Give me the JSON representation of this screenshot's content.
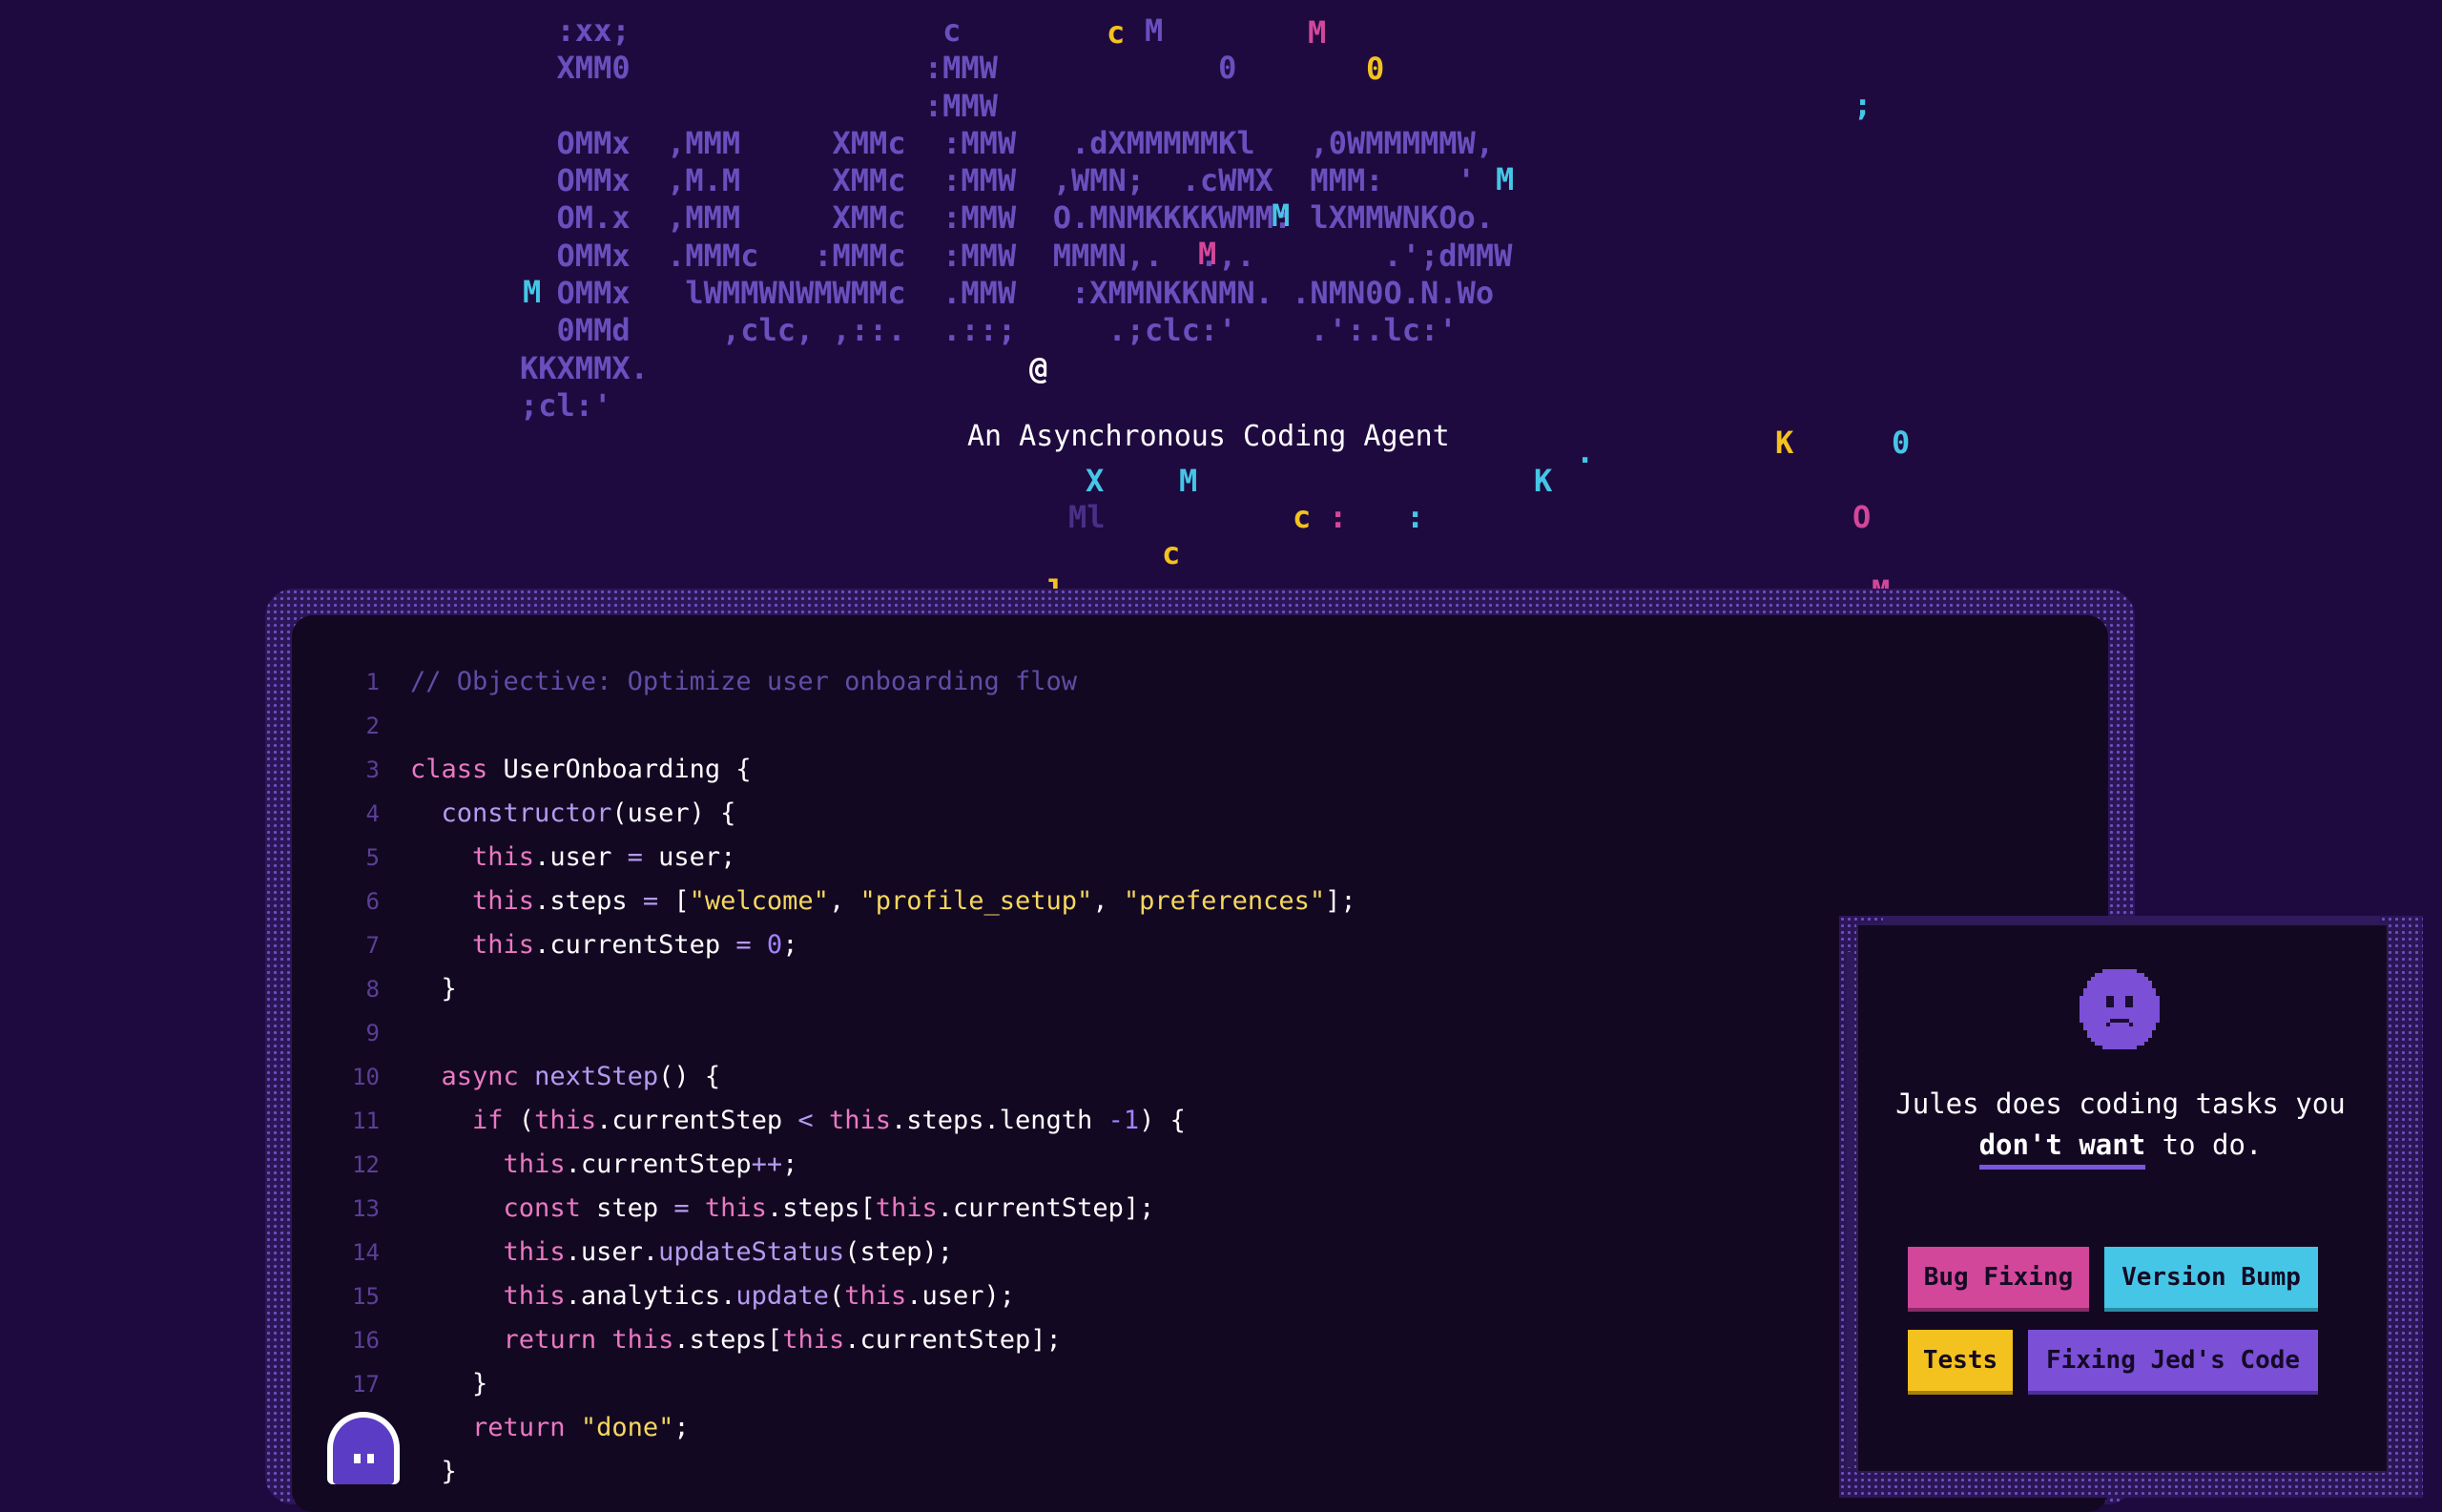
{
  "logo": {
    "ascii_lines": [
      "  :xx;                 c          M",
      "  XMM0                :MMW            0",
      "                      :MMW",
      "  OMMx  ,MMM     XMMc  :MMW   .dXMMMMMKl   ,0WMMMMMW,",
      "  OMMx  ,M.M     XMMc  :MMW  ,WMN;  .cWMX  MMM:    '",
      "  OM.x  ,MMM     XMMc  :MMW  O.MNMKKKKWMM: lXMMWNKOo.",
      "  OMMx  .MMMc   :MMMc  :MMW  MMMN,.  .,.       .';dMMW",
      "  OMMx   lWMMWNWMWMMc  .MMW   :XMMNKKNMN. .NMN0O.N.Wo",
      "  0MMd     ,clc, ,::.  .::;     .;clc:'    .':.lc:'",
      "KKXMMX.",
      ";cl:'"
    ],
    "floating_glyphs": [
      {
        "char": "c",
        "color": "#f4c21f"
      },
      {
        "char": "M",
        "color": "#d2479a"
      },
      {
        "char": "0",
        "color": "#f4c21f"
      },
      {
        "char": ";",
        "color": "#45c6e6"
      },
      {
        "char": "M",
        "color": "#45c6e6"
      },
      {
        "char": "M",
        "color": "#45c6e6"
      },
      {
        "char": "M",
        "color": "#d2479a"
      },
      {
        "char": "M",
        "color": "#45c6e6"
      },
      {
        "char": "@",
        "color": "#ffffff"
      },
      {
        "char": ".",
        "color": "#45c6e6"
      },
      {
        "char": "K",
        "color": "#f4c21f"
      },
      {
        "char": "0",
        "color": "#45c6e6"
      },
      {
        "char": "X",
        "color": "#45c6e6"
      },
      {
        "char": "M",
        "color": "#45c6e6"
      },
      {
        "char": "K",
        "color": "#45c6e6"
      },
      {
        "char": "Ml",
        "color": "#4a2f87"
      },
      {
        "char": "c",
        "color": "#f4c21f"
      },
      {
        "char": ":",
        "color": "#d2479a"
      },
      {
        "char": ":",
        "color": "#45c6e6"
      },
      {
        "char": "O",
        "color": "#d2479a"
      },
      {
        "char": "c",
        "color": "#f4c21f"
      },
      {
        "char": "l",
        "color": "#f4c21f"
      },
      {
        "char": "M",
        "color": "#d2479a"
      }
    ]
  },
  "subtitle": "An Asynchronous Coding Agent",
  "editor": {
    "lines": [
      {
        "n": "1",
        "tokens": [
          [
            "c-comment",
            "// Objective: Optimize user onboarding flow"
          ]
        ]
      },
      {
        "n": "2",
        "tokens": []
      },
      {
        "n": "3",
        "tokens": [
          [
            "c-kw",
            "class"
          ],
          [
            "c-plain",
            " UserOnboarding {"
          ]
        ]
      },
      {
        "n": "4",
        "tokens": [
          [
            "c-plain",
            "  "
          ],
          [
            "c-fn",
            "constructor"
          ],
          [
            "c-plain",
            "(user) {"
          ]
        ]
      },
      {
        "n": "5",
        "tokens": [
          [
            "c-plain",
            "    "
          ],
          [
            "c-this",
            "this"
          ],
          [
            "c-plain",
            ".user "
          ],
          [
            "c-op",
            "="
          ],
          [
            "c-plain",
            " user;"
          ]
        ]
      },
      {
        "n": "6",
        "tokens": [
          [
            "c-plain",
            "    "
          ],
          [
            "c-this",
            "this"
          ],
          [
            "c-plain",
            ".steps "
          ],
          [
            "c-op",
            "="
          ],
          [
            "c-plain",
            " ["
          ],
          [
            "c-str",
            "\"welcome\""
          ],
          [
            "c-plain",
            ", "
          ],
          [
            "c-str",
            "\"profile_setup\""
          ],
          [
            "c-plain",
            ", "
          ],
          [
            "c-str",
            "\"preferences\""
          ],
          [
            "c-plain",
            "];"
          ]
        ]
      },
      {
        "n": "7",
        "tokens": [
          [
            "c-plain",
            "    "
          ],
          [
            "c-this",
            "this"
          ],
          [
            "c-plain",
            ".currentStep "
          ],
          [
            "c-op",
            "="
          ],
          [
            "c-plain",
            " "
          ],
          [
            "c-num",
            "0"
          ],
          [
            "c-plain",
            ";"
          ]
        ]
      },
      {
        "n": "8",
        "tokens": [
          [
            "c-plain",
            "  }"
          ]
        ]
      },
      {
        "n": "9",
        "tokens": []
      },
      {
        "n": "10",
        "tokens": [
          [
            "c-plain",
            "  "
          ],
          [
            "c-kw",
            "async"
          ],
          [
            "c-plain",
            " "
          ],
          [
            "c-fn",
            "nextStep"
          ],
          [
            "c-plain",
            "() {"
          ]
        ]
      },
      {
        "n": "11",
        "tokens": [
          [
            "c-plain",
            "    "
          ],
          [
            "c-kw",
            "if"
          ],
          [
            "c-plain",
            " ("
          ],
          [
            "c-this",
            "this"
          ],
          [
            "c-plain",
            ".currentStep "
          ],
          [
            "c-op",
            "<"
          ],
          [
            "c-plain",
            " "
          ],
          [
            "c-this",
            "this"
          ],
          [
            "c-plain",
            ".steps.length "
          ],
          [
            "c-num",
            "-1"
          ],
          [
            "c-plain",
            ") {"
          ]
        ]
      },
      {
        "n": "12",
        "tokens": [
          [
            "c-plain",
            "      "
          ],
          [
            "c-this",
            "this"
          ],
          [
            "c-plain",
            ".currentStep"
          ],
          [
            "c-op",
            "++"
          ],
          [
            "c-plain",
            ";"
          ]
        ]
      },
      {
        "n": "13",
        "tokens": [
          [
            "c-plain",
            "      "
          ],
          [
            "c-kw",
            "const"
          ],
          [
            "c-plain",
            " step "
          ],
          [
            "c-op",
            "="
          ],
          [
            "c-plain",
            " "
          ],
          [
            "c-this",
            "this"
          ],
          [
            "c-plain",
            ".steps["
          ],
          [
            "c-this",
            "this"
          ],
          [
            "c-plain",
            ".currentStep];"
          ]
        ]
      },
      {
        "n": "14",
        "tokens": [
          [
            "c-plain",
            "      "
          ],
          [
            "c-this",
            "this"
          ],
          [
            "c-plain",
            ".user."
          ],
          [
            "c-fn",
            "updateStatus"
          ],
          [
            "c-plain",
            "(step);"
          ]
        ]
      },
      {
        "n": "15",
        "tokens": [
          [
            "c-plain",
            "      "
          ],
          [
            "c-this",
            "this"
          ],
          [
            "c-plain",
            ".analytics."
          ],
          [
            "c-fn",
            "update"
          ],
          [
            "c-plain",
            "("
          ],
          [
            "c-this",
            "this"
          ],
          [
            "c-plain",
            ".user);"
          ]
        ]
      },
      {
        "n": "16",
        "tokens": [
          [
            "c-plain",
            "      "
          ],
          [
            "c-kw",
            "return"
          ],
          [
            "c-plain",
            " "
          ],
          [
            "c-this",
            "this"
          ],
          [
            "c-plain",
            ".steps["
          ],
          [
            "c-this",
            "this"
          ],
          [
            "c-plain",
            ".currentStep];"
          ]
        ]
      },
      {
        "n": "17",
        "tokens": [
          [
            "c-plain",
            "    }"
          ]
        ]
      },
      {
        "n": "",
        "tokens": [
          [
            "c-plain",
            "    "
          ],
          [
            "c-kw",
            "return"
          ],
          [
            "c-plain",
            " "
          ],
          [
            "c-str",
            "\"done\""
          ],
          [
            "c-plain",
            ";"
          ]
        ]
      },
      {
        "n": "",
        "tokens": [
          [
            "c-plain",
            "  }"
          ]
        ]
      }
    ]
  },
  "card": {
    "text_before": "Jules does coding tasks you",
    "text_emphasis": "don't want",
    "text_after": " to do.",
    "tags": {
      "bug": "Bug Fixing",
      "version": "Version Bump",
      "tests": "Tests",
      "jed": "Fixing Jed's Code"
    }
  },
  "colors": {
    "background": "#1f0a3f",
    "ascii": "#6a4fbe",
    "pink": "#d2479a",
    "cyan": "#45c6e6",
    "yellow": "#f4c21f",
    "purple": "#7b4fd6"
  }
}
